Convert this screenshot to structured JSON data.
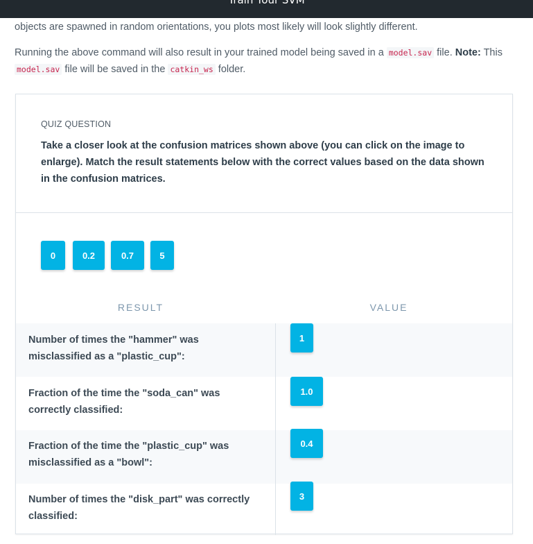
{
  "header": {
    "title": "Train Your SVM"
  },
  "content": {
    "para1": "objects are spawned in random orientations, you plots most likely will look slightly different.",
    "para2": {
      "part1": "Running the above command will also result in your trained model being saved in a ",
      "code1": "model.sav",
      "part2": " file. ",
      "note": "Note:",
      "part3": " This ",
      "code2": "model.sav",
      "part4": " file will be saved in the ",
      "code3": "catkin_ws",
      "part5": " folder."
    }
  },
  "quiz": {
    "kicker": "QUIZ QUESTION",
    "question": "Take a closer look at the confusion matrices shown above (you can click on the image to enlarge). Match the result statements below with the correct values based on the data shown in the confusion matrices.",
    "options": [
      "0",
      "0.2",
      "0.7",
      "5"
    ],
    "columns": {
      "result": "RESULT",
      "value": "VALUE"
    },
    "rows": [
      {
        "result": "Number of times the \"hammer\" was misclassified as a \"plastic_cup\":",
        "value": "1"
      },
      {
        "result": "Fraction of the time the \"soda_can\" was correctly classified:",
        "value": "1.0"
      },
      {
        "result": "Fraction of the time the \"plastic_cup\" was misclassified as a \"bowl\":",
        "value": "0.4"
      },
      {
        "result": "Number of times the \"disk_part\" was correctly classified:",
        "value": "3"
      }
    ]
  }
}
